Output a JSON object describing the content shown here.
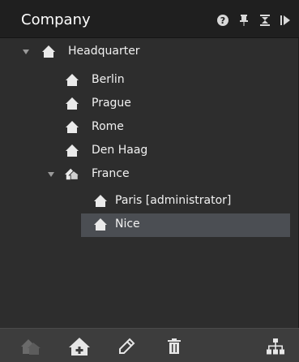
{
  "panel": {
    "title": "Company",
    "header_icons": [
      "help-icon",
      "pin-icon",
      "collapse-vertical-icon",
      "expand-right-icon"
    ]
  },
  "tree": {
    "nodes": [
      {
        "label": "Headquarter",
        "level": 0,
        "expanded": true,
        "icon": "house-icon"
      },
      {
        "label": "Berlin",
        "level": 1,
        "icon": "house-icon"
      },
      {
        "label": "Prague",
        "level": 1,
        "icon": "house-icon"
      },
      {
        "label": "Rome",
        "level": 1,
        "icon": "house-icon"
      },
      {
        "label": "Den Haag",
        "level": 1,
        "icon": "house-icon"
      },
      {
        "label": "France",
        "level": 1,
        "expanded": true,
        "icon": "house-group-icon"
      },
      {
        "label": "Paris [administrator]",
        "level": 2,
        "icon": "house-icon"
      },
      {
        "label": "Nice",
        "level": 2,
        "icon": "house-icon",
        "selected": true
      }
    ]
  },
  "toolbar": {
    "buttons": [
      "add-group-icon",
      "add-house-icon",
      "edit-icon",
      "delete-icon",
      "org-chart-icon"
    ]
  },
  "colors": {
    "header_bg": "#1f1f1f",
    "panel_bg": "#2d2d2d",
    "selected_bg": "#4b4e53",
    "footer_bg": "#3d3d3d",
    "text": "#f1f1f1"
  }
}
